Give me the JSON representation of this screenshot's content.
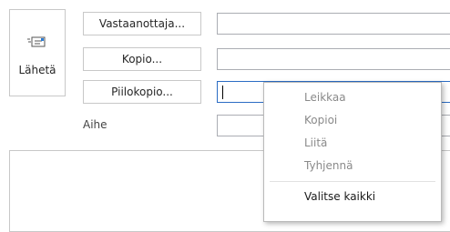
{
  "send": {
    "label": "Lähetä",
    "icon": "envelope-send-icon"
  },
  "header": {
    "to_label": "Vastaanottaja...",
    "cc_label": "Kopio...",
    "bcc_label": "Piilokopio...",
    "subject_label": "Aihe"
  },
  "fields": {
    "to_value": "",
    "cc_value": "",
    "bcc_value": "",
    "subject_value": ""
  },
  "context_menu": {
    "items": [
      {
        "label": "Leikkaa",
        "enabled": false
      },
      {
        "label": "Kopioi",
        "enabled": false
      },
      {
        "label": "Liitä",
        "enabled": false
      },
      {
        "label": "Tyhjennä",
        "enabled": false
      },
      {
        "label": "Valitse kaikki",
        "enabled": true
      }
    ]
  },
  "colors": {
    "active_border": "#2b6cc4",
    "disabled_text": "#8a8a8a",
    "icon_accent": "#2a7cd6"
  }
}
